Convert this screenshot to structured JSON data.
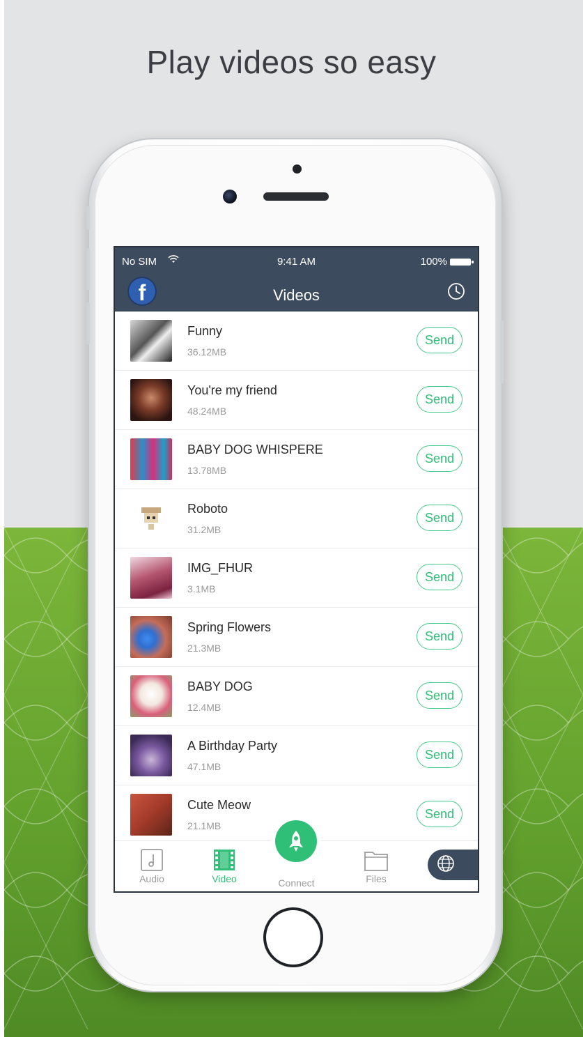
{
  "headline": "Play videos so easy",
  "status_bar": {
    "carrier": "No SIM",
    "time": "9:41 AM",
    "battery": "100%"
  },
  "nav": {
    "title": "Videos",
    "left_icon": "facebook-icon",
    "right_icon": "history-clock-icon"
  },
  "videos": [
    {
      "name": "Funny",
      "size": "36.12MB",
      "send_label": "Send"
    },
    {
      "name": "You're my friend",
      "size": "48.24MB",
      "send_label": "Send"
    },
    {
      "name": "BABY DOG WHISPERE",
      "size": "13.78MB",
      "send_label": "Send"
    },
    {
      "name": "Roboto",
      "size": "31.2MB",
      "send_label": "Send"
    },
    {
      "name": "IMG_FHUR",
      "size": "3.1MB",
      "send_label": "Send"
    },
    {
      "name": "Spring Flowers",
      "size": "21.3MB",
      "send_label": "Send"
    },
    {
      "name": "BABY DOG",
      "size": "12.4MB",
      "send_label": "Send"
    },
    {
      "name": "A Birthday  Party",
      "size": "47.1MB",
      "send_label": "Send"
    },
    {
      "name": "Cute Meow",
      "size": "21.1MB",
      "send_label": "Send"
    }
  ],
  "tabs": [
    {
      "label": "Audio",
      "icon": "music-note-icon"
    },
    {
      "label": "Video",
      "icon": "film-icon",
      "active": true
    },
    {
      "label": "Connect",
      "icon": "rocket-icon"
    },
    {
      "label": "Files",
      "icon": "folder-icon"
    },
    {
      "label": "",
      "icon": "globe-icon"
    }
  ],
  "colors": {
    "accent": "#2fbf76",
    "header_bg": "#3c4b5d",
    "background_top": "#e3e4e6",
    "background_bottom": "#6aa834"
  }
}
